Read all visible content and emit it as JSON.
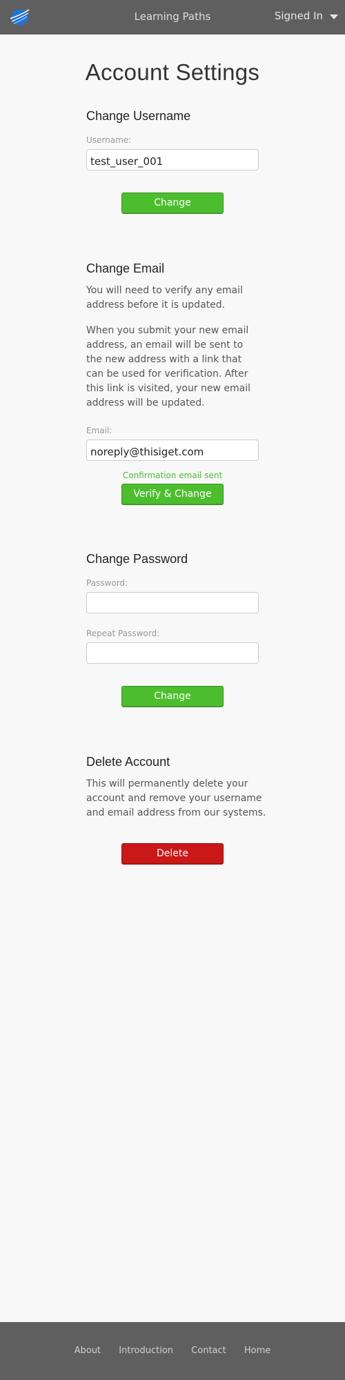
{
  "header": {
    "title": "Learning Paths",
    "user_menu_label": "Signed In",
    "logo_icon": "globe-swoosh-logo",
    "background": "#5f5f5f"
  },
  "page": {
    "title": "Account Settings"
  },
  "username_section": {
    "heading": "Change Username",
    "label": "Username:",
    "value": "test_user_001",
    "button_label": "Change"
  },
  "email_section": {
    "heading": "Change Email",
    "paragraph_1": "You will need to verify any email address before it is updated.",
    "paragraph_2": "When you submit your new email address, an email will be sent to the new address with a link that can be used for verification. After this link is visited, your new email address will be updated.",
    "label": "Email:",
    "value": "noreply@thisiget.com",
    "notice": "Confirmation email sent",
    "button_label": "Verify & Change"
  },
  "password_section": {
    "heading": "Change Password",
    "password_label": "Password:",
    "password_value": "",
    "repeat_label": "Repeat Password:",
    "repeat_value": "",
    "button_label": "Change"
  },
  "delete_section": {
    "heading": "Delete Account",
    "paragraph": "This will permanently delete your account and remove your username and email address from our systems.",
    "button_label": "Delete"
  },
  "footer": {
    "links": [
      "About",
      "Introduction",
      "Contact",
      "Home"
    ]
  },
  "colors": {
    "accent_green": "#4cbe2e",
    "danger_red": "#c91817",
    "bar_gray": "#5f5f5f",
    "background": "#f8f8f8"
  }
}
